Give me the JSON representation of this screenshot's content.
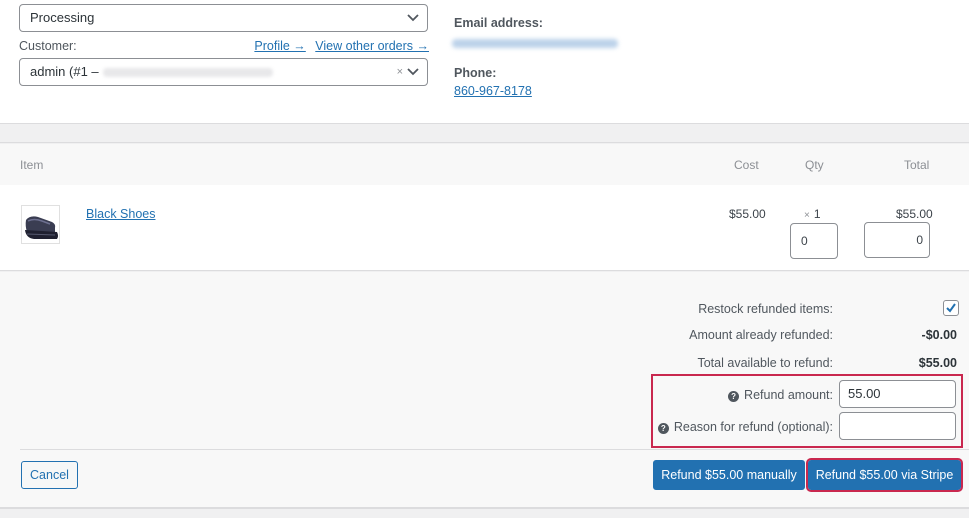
{
  "order": {
    "status": "Processing",
    "customer_label": "Customer:",
    "customer_links": [
      "Profile →",
      "View other orders →"
    ],
    "customer_value": "admin (#1 –",
    "clear_symbol": "×",
    "email_label": "Email address:",
    "phone_label": "Phone:",
    "phone": "860-967-8178"
  },
  "items": {
    "headers": {
      "item": "Item",
      "cost": "Cost",
      "qty": "Qty",
      "total": "Total"
    },
    "rows": [
      {
        "name": "Black Shoes",
        "cost": "$55.00",
        "qty_times": "×",
        "qty": "1",
        "refund_qty": "0",
        "total": "$55.00",
        "refund_total": "0"
      }
    ]
  },
  "refund": {
    "restock_label": "Restock refunded items:",
    "restock_checked": true,
    "already_label": "Amount already refunded:",
    "already_value": "-$0.00",
    "available_label": "Total available to refund:",
    "available_value": "$55.00",
    "amount_label": "Refund amount:",
    "amount_value": "55.00",
    "reason_label": "Reason for refund (optional):",
    "reason_value": "",
    "help_glyph": "?",
    "cancel_label": "Cancel",
    "manual_label": "Refund $55.00 manually",
    "stripe_label": "Refund $55.00 via Stripe"
  },
  "colors": {
    "accent": "#2271b1",
    "highlight": "#c9284f"
  }
}
